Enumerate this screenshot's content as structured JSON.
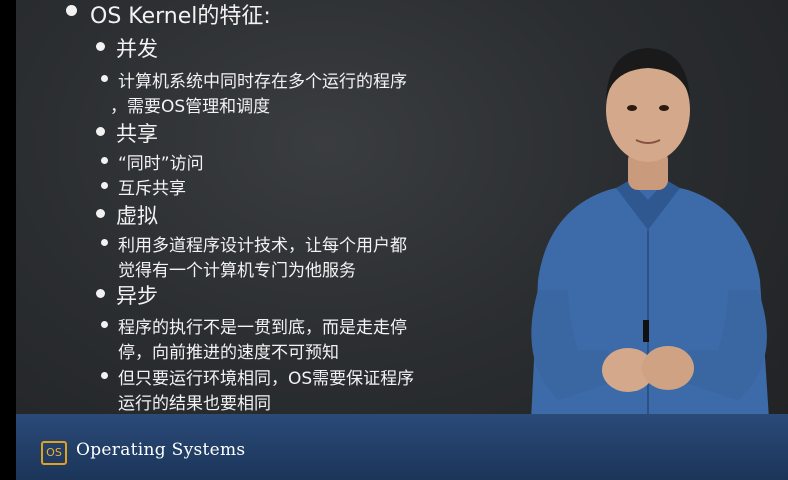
{
  "slide": {
    "heading": "OS Kernel的特征:",
    "items": [
      {
        "label": "并发",
        "details": [
          "计算机系统中同时存在多个运行的程序",
          "，需要OS管理和调度"
        ]
      },
      {
        "label": "共享",
        "details": [
          "“同时”访问",
          "互斥共享"
        ]
      },
      {
        "label": "虚拟",
        "details": [
          "利用多道程序设计技术，让每个用户都",
          "觉得有一个计算机专门为他服务"
        ]
      },
      {
        "label": "异步",
        "details": [
          "程序的执行不是一贯到底，而是走走停",
          "停，向前推进的速度不可预知",
          "但只要运行环境相同，OS需要保证程序",
          "运行的结果也要相同"
        ]
      }
    ]
  },
  "banner": {
    "logo_text": "OS",
    "title": "Operating Systems"
  },
  "colors": {
    "board": "#2b2e31",
    "banner": "#1b3559",
    "logo_accent": "#e0a020",
    "shirt": "#3d6aa8"
  }
}
